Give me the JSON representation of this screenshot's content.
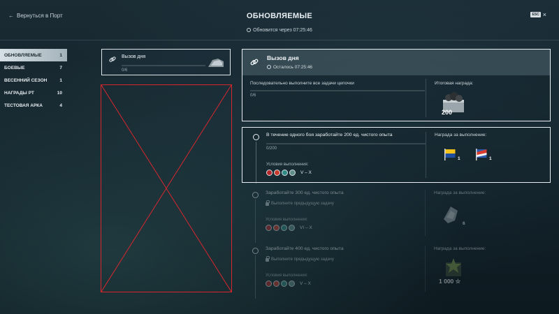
{
  "header": {
    "back_label": "Вернуться в Порт",
    "title": "ОБНОВЛЯЕМЫЕ",
    "esc_key": "ESC",
    "close_glyph": "×",
    "timer": "Обновится через 07:25:46"
  },
  "sidebar": {
    "items": [
      {
        "label": "ОБНОВЛЯЕМЫЕ",
        "count": "1",
        "active": true
      },
      {
        "label": "БОЕВЫЕ",
        "count": "7",
        "active": false
      },
      {
        "label": "ВЕСЕННИЙ СЕЗОН",
        "count": "1",
        "active": false
      },
      {
        "label": "НАГРАДЫ РТ",
        "count": "10",
        "active": false
      },
      {
        "label": "ТЕСТОВАЯ АРКА",
        "count": "4",
        "active": false
      }
    ]
  },
  "chain_card": {
    "title": "Вызов дня",
    "progress": "0/6",
    "icon": "link-icon"
  },
  "detail": {
    "title": "Вызов дня",
    "remaining": "Осталось 07:25:46",
    "description": "Последовательно выполните все задачи цепочки",
    "progress": "0/6",
    "final_reward_label": "Итоговая награда:",
    "final_reward_value": "200",
    "final_reward_icon": "coal-icon"
  },
  "tasks": [
    {
      "title": "В течение одного боя заработайте 200 ед. чистого опыта",
      "progress": "0/200",
      "conditions_label": "Условия выполнения:",
      "tiers": "V – X",
      "reward_label": "Награда за выполнение:",
      "rewards": [
        {
          "icon": "signal-flag-icon",
          "qty": "1"
        },
        {
          "icon": "signal-flag-icon",
          "qty": "1"
        }
      ]
    },
    {
      "title": "Заработайте 300 ед. чистого опыта",
      "locked_label": "Выполните предыдущую задачу",
      "conditions_label": "Условия выполнения:",
      "tiers": "VI – X",
      "reward_label": "Награда за выполнение:",
      "rewards": [
        {
          "icon": "camouflage-icon",
          "qty": "6"
        }
      ]
    },
    {
      "title": "Заработайте 400 ед. чистого опыта",
      "locked_label": "Выполните предыдущую задачу",
      "conditions_label": "Условия выполнения:",
      "tiers": "V – X",
      "reward_label": "Награда за выполнение:",
      "rewards": [
        {
          "icon": "free-xp-icon",
          "qty": "1 000"
        }
      ]
    }
  ],
  "colors": {
    "placeholder_border": "#d8262e",
    "active_sidebar": "#e6eff3",
    "panel_border": "#e8eef1"
  }
}
